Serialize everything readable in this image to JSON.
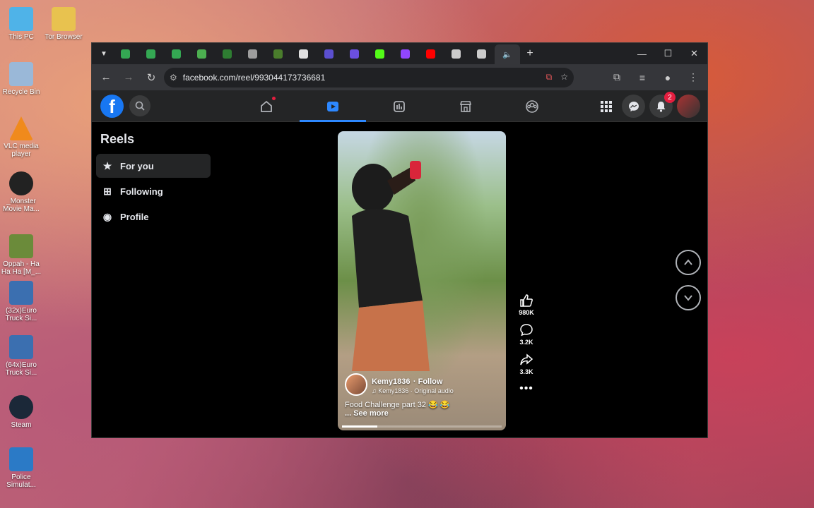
{
  "desktop": {
    "icons": [
      {
        "label": "This PC",
        "color": "#4fb3e8"
      },
      {
        "label": "Tor Browser",
        "color": "#e8c24f"
      },
      {
        "label": "Recycle Bin",
        "color": "#9ab8d8"
      },
      {
        "label": "VLC media player",
        "color": "#f08a1c"
      },
      {
        "label": "_Monster Movie Ma...",
        "color": "#222222"
      },
      {
        "label": "Oppah - Ha Ha Ha [M_...",
        "color": "#6b8b3a"
      },
      {
        "label": "(32x)Euro Truck Si...",
        "color": "#3b6fb0"
      },
      {
        "label": "(64x)Euro Truck Si...",
        "color": "#3b6fb0"
      },
      {
        "label": "Steam",
        "color": "#1b2838"
      },
      {
        "label": "Police Simulat...",
        "color": "#2b7ac6"
      }
    ]
  },
  "browser": {
    "tabs": [
      {
        "icon": "google-drive-icon",
        "color": "#34a853"
      },
      {
        "icon": "google-drive-icon",
        "color": "#34a853"
      },
      {
        "icon": "google-drive-icon",
        "color": "#34a853"
      },
      {
        "icon": "tab-icon",
        "color": "#4caf50"
      },
      {
        "icon": "tab-icon",
        "color": "#2e7d32"
      },
      {
        "icon": "globe-icon",
        "color": "#9e9e9e"
      },
      {
        "icon": "tab-icon",
        "color": "#4a7d2c"
      },
      {
        "icon": "tab-icon",
        "color": "#e0e0e0"
      },
      {
        "icon": "tab-icon",
        "color": "#5b4fcf"
      },
      {
        "icon": "tab-icon",
        "color": "#6b4fe0"
      },
      {
        "icon": "kick-icon",
        "color": "#53fc18"
      },
      {
        "icon": "twitch-icon",
        "color": "#9146ff"
      },
      {
        "icon": "youtube-icon",
        "color": "#ff0000"
      },
      {
        "icon": "tab-icon",
        "color": "#cccccc"
      },
      {
        "icon": "tab-icon",
        "color": "#cccccc"
      }
    ],
    "url": "facebook.com/reel/993044173736681"
  },
  "facebook": {
    "logo_letter": "f",
    "notifications_count": "2",
    "sidebar": {
      "title": "Reels",
      "items": [
        {
          "label": "For you",
          "icon": "star-icon"
        },
        {
          "label": "Following",
          "icon": "following-icon"
        },
        {
          "label": "Profile",
          "icon": "profile-icon"
        }
      ]
    },
    "reel": {
      "author": "Kemy1836",
      "follow": "· Follow",
      "audio": "♫ Kemy1836 · Original audio",
      "caption": "Food Challenge part 32 😂 😂",
      "see_more": "... See more",
      "likes": "980K",
      "comments": "3.2K",
      "shares": "3.3K",
      "progress": 0.22
    }
  }
}
